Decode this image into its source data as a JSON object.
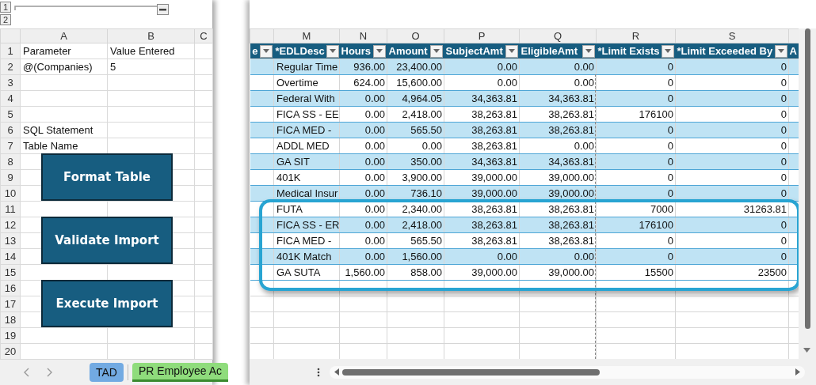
{
  "outline": {
    "levels": [
      "1",
      "2"
    ]
  },
  "left_sheet": {
    "columns": [
      "A",
      "B",
      "C"
    ],
    "rows": [
      {
        "number": "1",
        "a": "Parameter",
        "b": "Value Entered"
      },
      {
        "number": "2",
        "a": "@(Companies)",
        "b": "5"
      },
      {
        "number": "3"
      },
      {
        "number": "4"
      },
      {
        "number": "5"
      },
      {
        "number": "6",
        "a": "SQL Statement"
      },
      {
        "number": "7",
        "a": "Table Name"
      },
      {
        "number": "8"
      },
      {
        "number": "9"
      },
      {
        "number": "10"
      },
      {
        "number": "11"
      },
      {
        "number": "12"
      },
      {
        "number": "13"
      },
      {
        "number": "14"
      },
      {
        "number": "15"
      },
      {
        "number": "16"
      },
      {
        "number": "17"
      },
      {
        "number": "18"
      },
      {
        "number": "19"
      },
      {
        "number": "20"
      }
    ]
  },
  "buttons": [
    "Format Table",
    "Validate Import",
    "Execute Import"
  ],
  "sheet_tabs": [
    {
      "label": "TAD",
      "selected": false,
      "color": "#72aae2"
    },
    {
      "label": "PR Employee Ac",
      "selected": true,
      "color": "#8fdc7c"
    }
  ],
  "right_sheet": {
    "columns": [
      "M",
      "N",
      "O",
      "P",
      "Q",
      "R",
      "S"
    ],
    "headers": [
      "e",
      "*EDLDesc",
      "Hours",
      "Amount",
      "SubjectAmt",
      "EligibleAmt",
      "*Limit Exists",
      "*Limit Exceeded By",
      "A"
    ],
    "rows": [
      [
        "Regular Time",
        "936.00",
        "23,400.00",
        "0.00",
        "0.00",
        "0",
        "0"
      ],
      [
        "Overtime",
        "624.00",
        "15,600.00",
        "0.00",
        "0.00",
        "0",
        "0"
      ],
      [
        "Federal With",
        "0.00",
        "4,964.05",
        "34,363.81",
        "34,363.81",
        "0",
        "0"
      ],
      [
        "FICA SS - EE",
        "0.00",
        "2,418.00",
        "38,263.81",
        "38,263.81",
        "176100",
        "0"
      ],
      [
        "FICA MED -",
        "0.00",
        "565.50",
        "38,263.81",
        "38,263.81",
        "0",
        "0"
      ],
      [
        "ADDL MED",
        "0.00",
        "0.00",
        "38,263.81",
        "0.00",
        "0",
        "0"
      ],
      [
        "GA SIT",
        "0.00",
        "350.00",
        "34,363.81",
        "34,363.81",
        "0",
        "0"
      ],
      [
        "401K",
        "0.00",
        "3,900.00",
        "39,000.00",
        "39,000.00",
        "0",
        "0"
      ],
      [
        "Medical Insur",
        "0.00",
        "736.10",
        "39,000.00",
        "39,000.00",
        "0",
        "0"
      ],
      [
        "FUTA",
        "0.00",
        "2,340.00",
        "38,263.81",
        "38,263.81",
        "7000",
        "31263.81"
      ],
      [
        "FICA SS - ER",
        "0.00",
        "2,418.00",
        "38,263.81",
        "38,263.81",
        "176100",
        "0"
      ],
      [
        "FICA MED -",
        "0.00",
        "565.50",
        "38,263.81",
        "38,263.81",
        "0",
        "0"
      ],
      [
        "401K Match",
        "0.00",
        "1,560.00",
        "0.00",
        "0.00",
        "0",
        "0"
      ],
      [
        "GA SUTA",
        "1,560.00",
        "858.00",
        "39,000.00",
        "39,000.00",
        "15500",
        "23500"
      ]
    ]
  }
}
